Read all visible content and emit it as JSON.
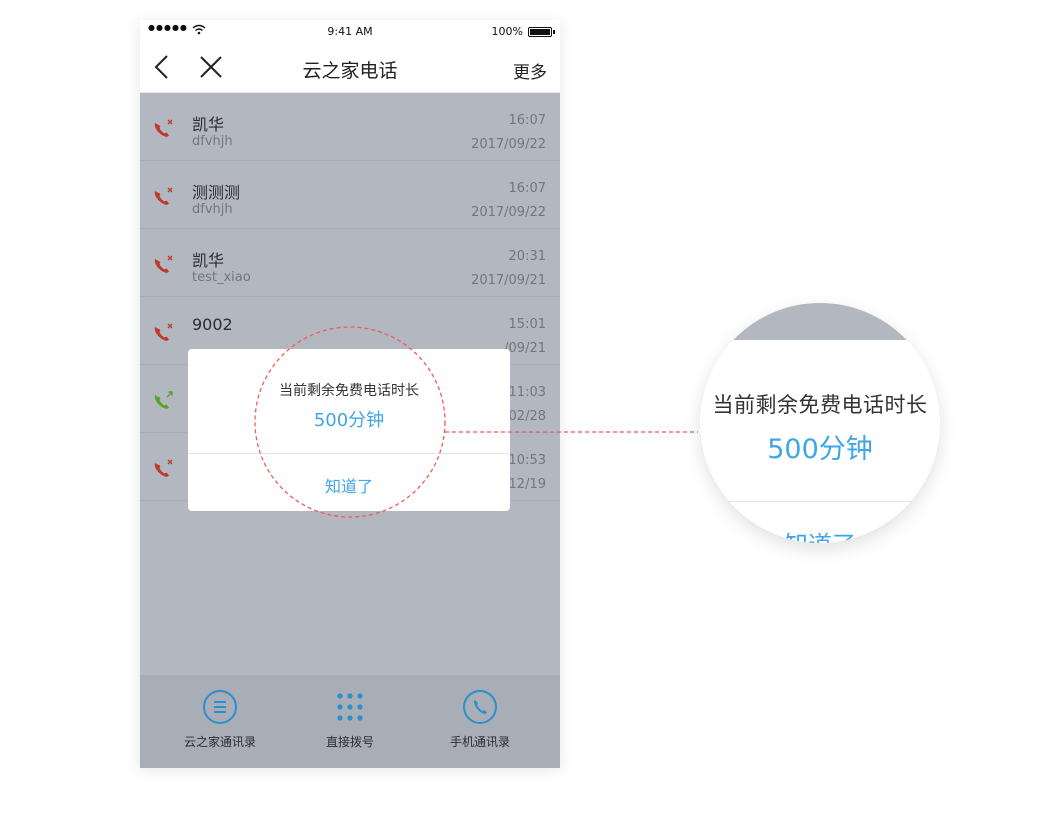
{
  "status_bar": {
    "signal": "●●●●●",
    "time": "9:41 AM",
    "battery": "100%",
    "battery_level": 1.0
  },
  "nav": {
    "title": "云之家电话",
    "more_label": "更多",
    "back_icon": "chevron-left-icon",
    "close_icon": "close-icon"
  },
  "calls": [
    {
      "name": "凯华",
      "account": "dfvhjh",
      "time": "16:07",
      "date": "2017/09/22",
      "type": "missed"
    },
    {
      "name": "测测测",
      "account": "dfvhjh",
      "time": "16:07",
      "date": "2017/09/22",
      "type": "missed"
    },
    {
      "name": "凯华",
      "account": "test_xiao",
      "time": "20:31",
      "date": "2017/09/21",
      "type": "missed"
    },
    {
      "name": "9002",
      "account": "",
      "time": "15:01",
      "date": "/09/21",
      "type": "missed"
    },
    {
      "name": "",
      "account": "",
      "time": "11:03",
      "date": "/02/28",
      "type": "outgoing"
    },
    {
      "name": "",
      "account": "",
      "time": "10:53",
      "date": "/12/19",
      "type": "missed"
    }
  ],
  "dialog": {
    "message": "当前剩余免费电话时长",
    "minutes": "500分钟",
    "confirm_label": "知道了"
  },
  "zoom": {
    "message": "当前剩余免费电话时长",
    "minutes": "500分钟",
    "confirm_label": "知道了"
  },
  "tabs": [
    {
      "label": "云之家通讯录",
      "icon": "contacts-list-icon"
    },
    {
      "label": "直接拨号",
      "icon": "dialpad-icon"
    },
    {
      "label": "手机通讯录",
      "icon": "phone-icon"
    }
  ],
  "colors": {
    "accent": "#3ea6e6",
    "missed": "#c0392b",
    "outgoing": "#5aa02c",
    "dim_overlay": "#b3b7bf",
    "callout_dash": "#f25a5a"
  }
}
